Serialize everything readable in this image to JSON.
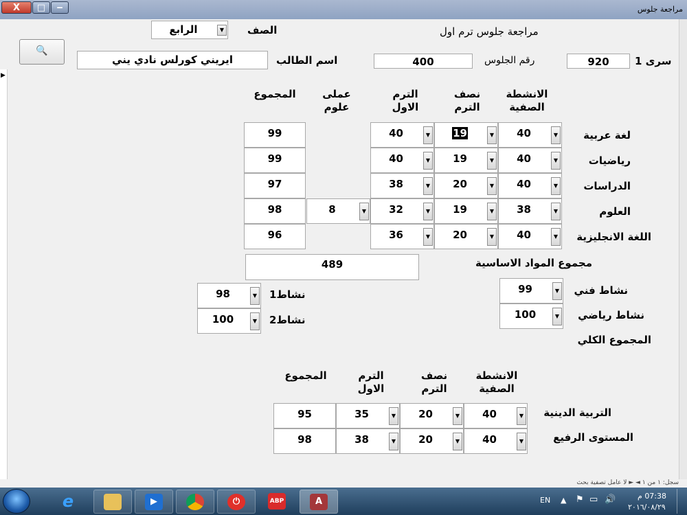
{
  "window": {
    "title": "مراجعة جلوس",
    "close_label": "X",
    "max_label": "□",
    "min_label": "‒"
  },
  "header": {
    "form_title": "مراجعة جلوس ترم اول",
    "grade_label": "الصف",
    "grade_value": "الرابع",
    "student_label": "اسم الطالب",
    "student_value": "ايريني كورلس نادي يني",
    "seat_label": "رقم الجلوس",
    "seat_value": "400",
    "serial_label": "سرى 1",
    "serial_value": "920",
    "search_icon_glyph": "🔍"
  },
  "main_table": {
    "headers": {
      "activities": "الانشطة الصفية",
      "midterm": "نصف الترم",
      "term1": "الترم الاول",
      "practical": "عملى علوم",
      "total": "المجموع"
    },
    "rows": [
      {
        "subject": "لغة عربية",
        "activities": "40",
        "midterm": "19",
        "term1": "40",
        "practical": "",
        "total": "99"
      },
      {
        "subject": "رياضيات",
        "activities": "40",
        "midterm": "19",
        "term1": "40",
        "practical": "",
        "total": "99"
      },
      {
        "subject": "الدراسات",
        "activities": "40",
        "midterm": "20",
        "term1": "38",
        "practical": "",
        "total": "97"
      },
      {
        "subject": "العلوم",
        "activities": "38",
        "midterm": "19",
        "term1": "32",
        "practical": "8",
        "total": "98"
      },
      {
        "subject": "اللغة الانجليزية",
        "activities": "40",
        "midterm": "20",
        "term1": "36",
        "practical": "",
        "total": "96"
      }
    ],
    "basic_total_label": "مجموع المواد الاساسية",
    "basic_total_value": "489"
  },
  "activities": {
    "art_label": "نشاط فني",
    "art_value": "99",
    "sport_label": "نشاط رياضي",
    "sport_value": "100",
    "activity1_label": "نشاط1",
    "activity1_value": "98",
    "activity2_label": "نشاط2",
    "activity2_value": "100",
    "grand_total_label": "المجموع الكلي"
  },
  "secondary_table": {
    "headers": {
      "activities": "الانشطة الصفية",
      "midterm": "نصف الترم",
      "term1": "الترم الاول",
      "total": "المجموع"
    },
    "rows": [
      {
        "subject": "التربية الدينية",
        "activities": "40",
        "midterm": "20",
        "term1": "35",
        "total": "95"
      },
      {
        "subject": "المستوى الرفيع",
        "activities": "40",
        "midterm": "20",
        "term1": "38",
        "total": "98"
      }
    ]
  },
  "record_nav": {
    "text": "سجل: ١ من ١ ◄ ► لا عامل تصفية بحث"
  },
  "taskbar": {
    "language": "EN",
    "time": "07:38 م",
    "date": "٢٠١٦/٠٨/٢٩"
  },
  "colors": {
    "form_bg": "#f0f0f0",
    "close_button": "#c0392b",
    "taskbar": "#2b4c6f"
  }
}
